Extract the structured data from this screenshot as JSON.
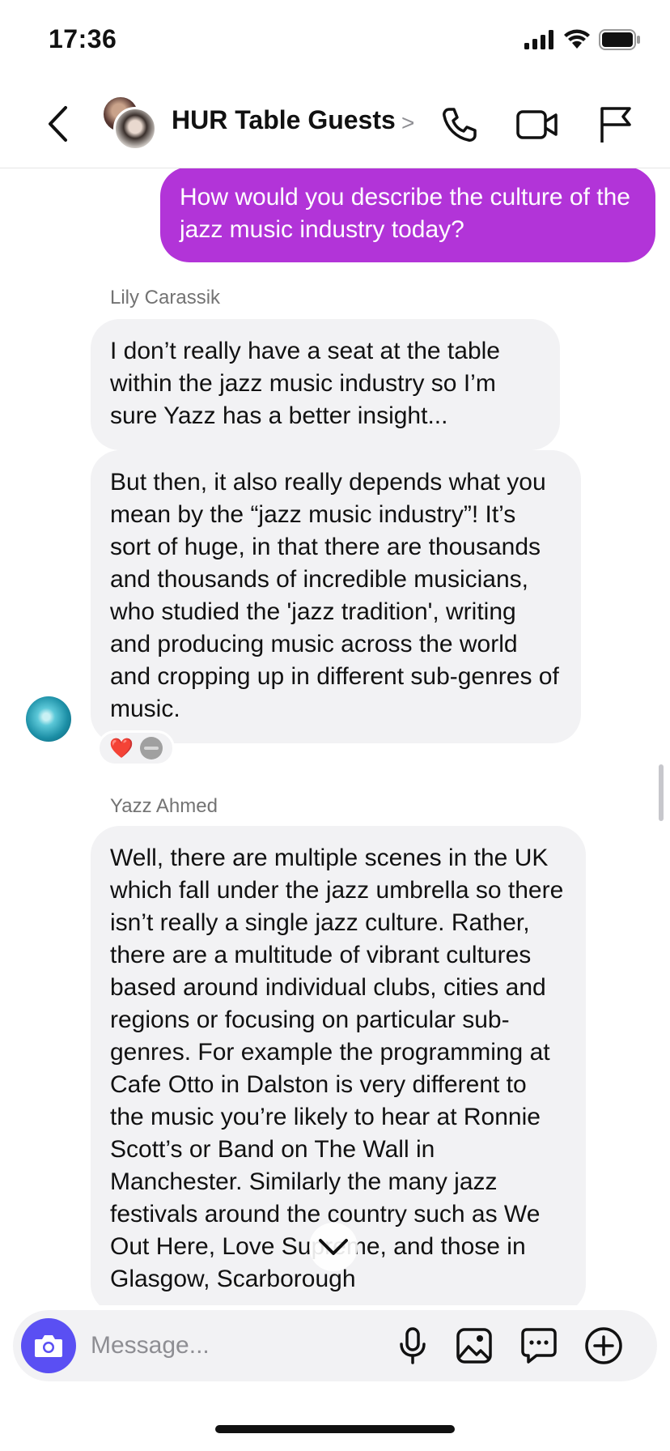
{
  "status_bar": {
    "time": "17:36"
  },
  "header": {
    "title": "HUR Table Guests",
    "chevron": ">"
  },
  "messages": {
    "outgoing": {
      "text": "How would you describe the culture of the jazz music industry today?"
    },
    "lily": {
      "sender": "Lily Carassik",
      "bubble1": "I don’t really have a seat at the table within the jazz music industry so I’m sure Yazz has a better insight...",
      "bubble2": "But then, it also really depends what you mean by the “jazz music industry”! It’s sort of huge, in that there are thousands and thousands of incredible musicians, who studied the 'jazz tradition', writing and producing music across the world and cropping up in different sub-genres of music.",
      "reactions": [
        "❤️",
        "neutral-face"
      ]
    },
    "yazz": {
      "sender": "Yazz Ahmed",
      "bubble": "Well, there are multiple scenes in the UK which fall under the jazz umbrella so there isn’t really a single jazz culture. Rather, there are a multitude of vibrant cultures based around individual clubs, cities and regions or focusing on particular sub-genres. For example the programming at Cafe Otto in Dalston is very different to the music you’re likely to hear at Ronnie Scott’s or Band on The Wall in Manchester. Similarly the many jazz festivals around the country such as We Out Here, Love Supreme, and those in Glasgow, Scarborough"
    }
  },
  "composer": {
    "placeholder": "Message..."
  },
  "colors": {
    "outgoing_bubble": "#b234d8",
    "incoming_bubble": "#f2f2f4",
    "camera_button": "#5a4ff3"
  }
}
